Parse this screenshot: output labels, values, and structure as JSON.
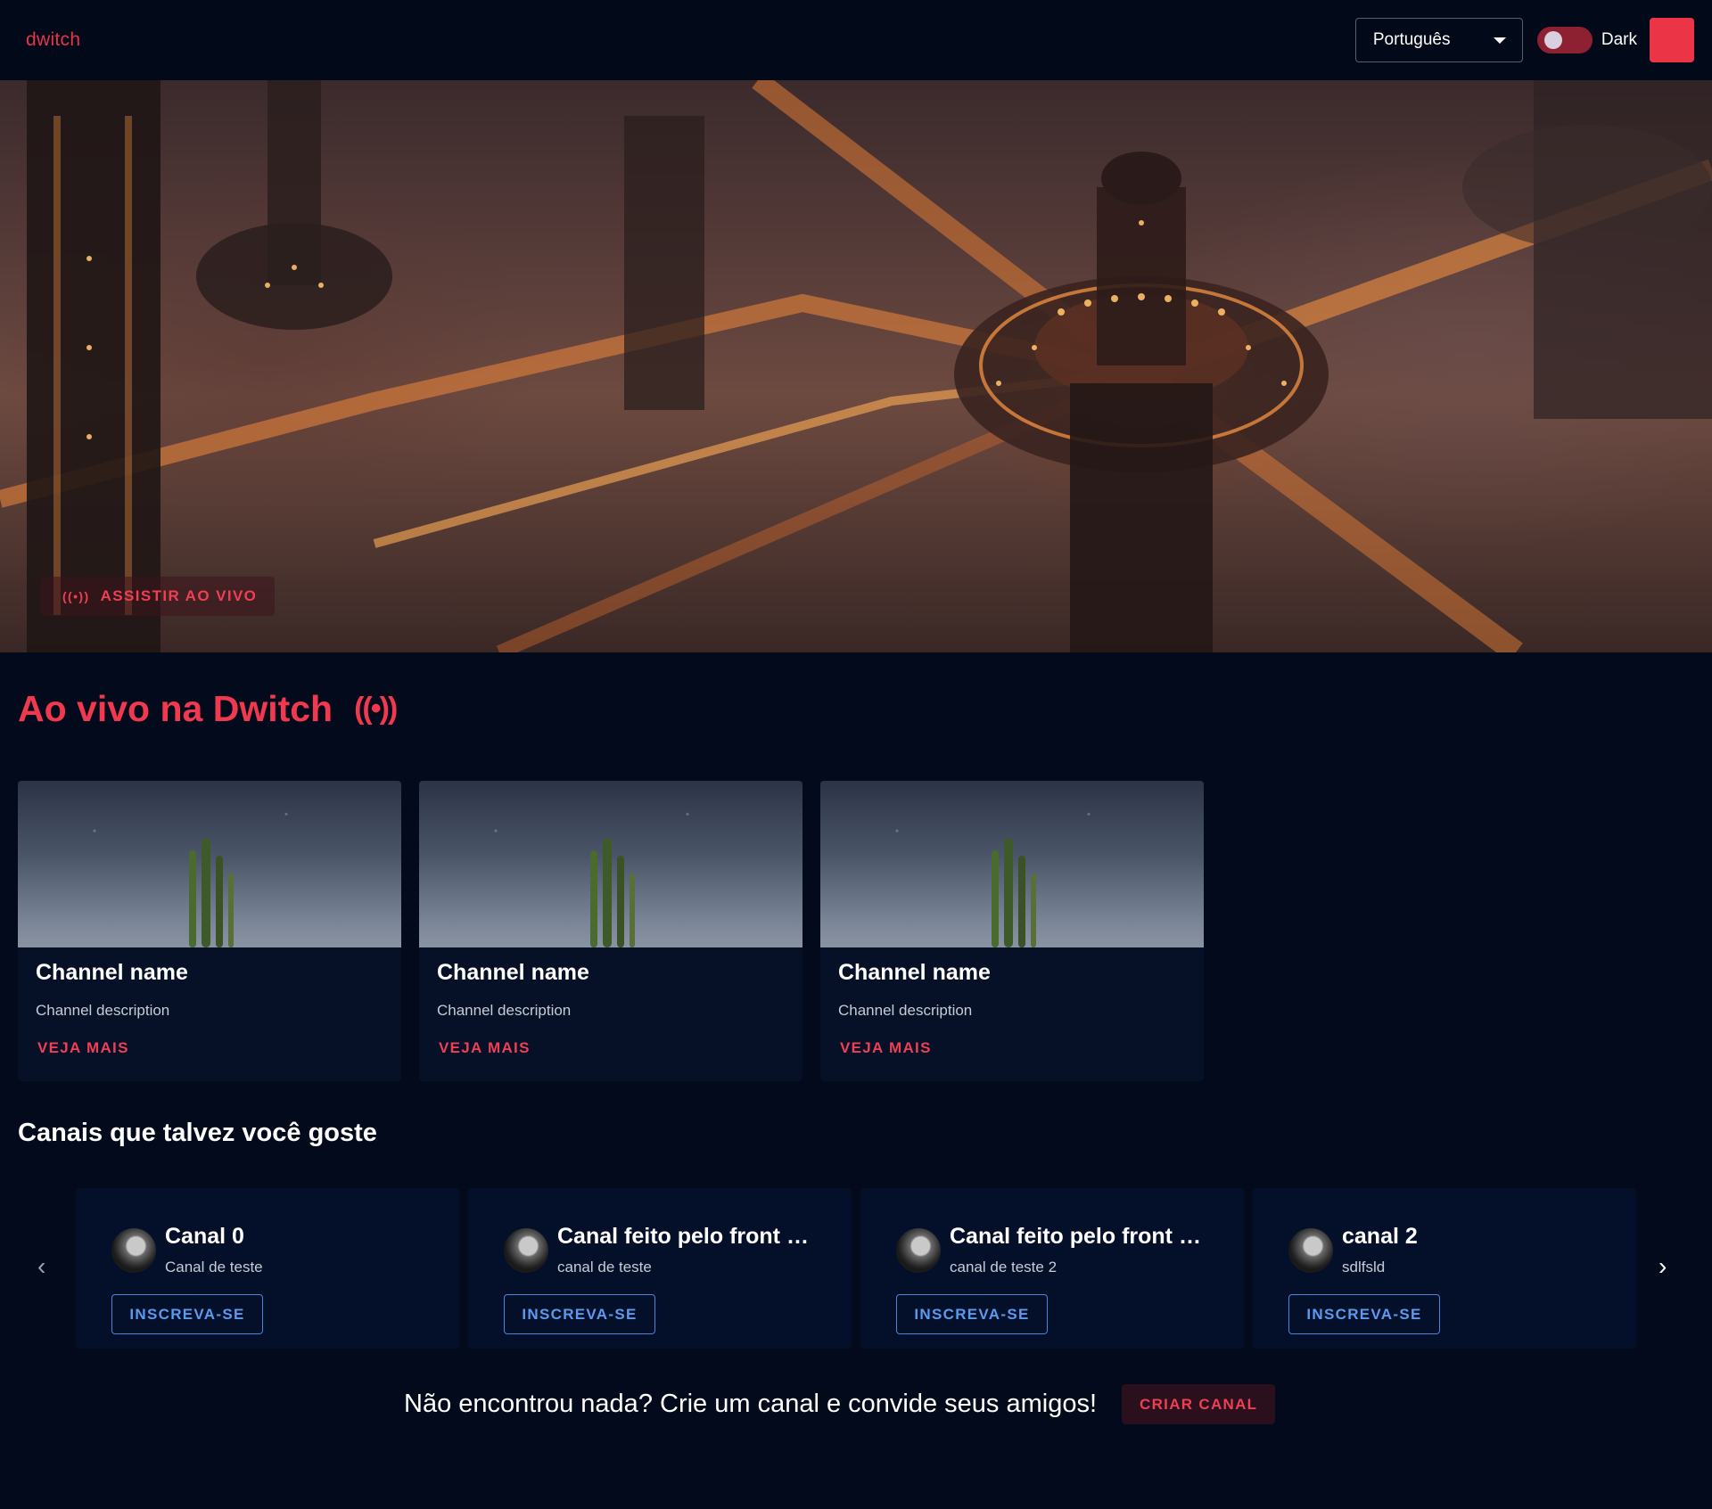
{
  "appbar": {
    "logo": "dwitch",
    "language": "Português",
    "theme_label": "Dark"
  },
  "hero": {
    "watch_live_label": "ASSISTIR AO VIVO"
  },
  "live": {
    "title": "Ao vivo na Dwitch",
    "cards": [
      {
        "name": "Channel name",
        "description": "Channel description",
        "more": "VEJA MAIS"
      },
      {
        "name": "Channel name",
        "description": "Channel description",
        "more": "VEJA MAIS"
      },
      {
        "name": "Channel name",
        "description": "Channel description",
        "more": "VEJA MAIS"
      }
    ]
  },
  "suggested": {
    "title": "Canais que talvez você goste",
    "cards": [
      {
        "name": "Canal 0",
        "description": "Canal de teste",
        "button": "INSCREVA-SE"
      },
      {
        "name": "Canal feito pelo front te...",
        "description": "canal de teste",
        "button": "INSCREVA-SE"
      },
      {
        "name": "Canal feito pelo front te...",
        "description": "canal de teste 2",
        "button": "INSCREVA-SE"
      },
      {
        "name": "canal 2",
        "description": "sdlfsld",
        "button": "INSCREVA-SE"
      }
    ]
  },
  "cta": {
    "message": "Não encontrou nada? Crie um canal e convide seus amigos!",
    "button": "CRIAR CANAL"
  },
  "colors": {
    "background": "#030a1b",
    "accent": "#ec3447",
    "card": "#061127",
    "subscribe": "#5a9af0"
  },
  "icons": {
    "live": "broadcast-icon",
    "dropdown": "caret-down-icon",
    "prev": "chevron-left-icon",
    "next": "chevron-right-icon"
  }
}
